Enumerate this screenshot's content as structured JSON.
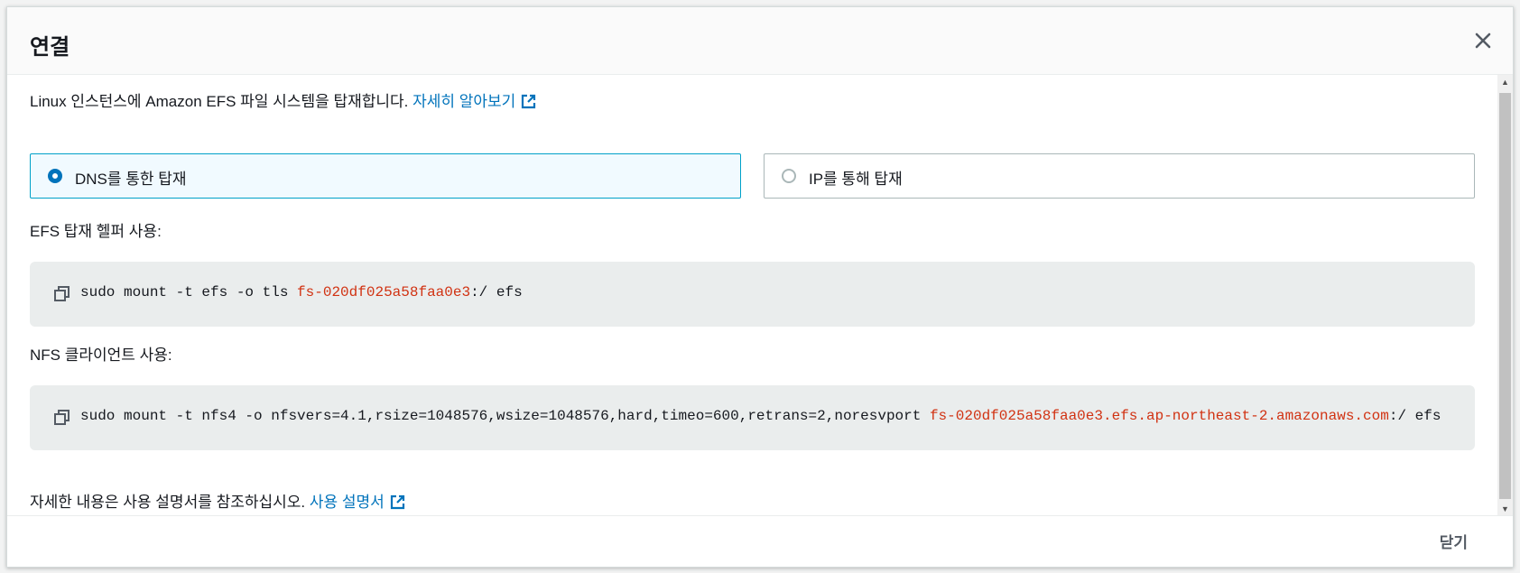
{
  "modal": {
    "title": "연결",
    "intro_text": "Linux 인스턴스에 Amazon EFS 파일 시스템을 탑재합니다. ",
    "intro_link": "자세히 알아보기",
    "options": {
      "dns_label": "DNS를 통한 탑재",
      "ip_label": "IP를 통해 탑재",
      "selected": "dns"
    },
    "efs_helper": {
      "label": "EFS 탑재 헬퍼 사용:",
      "command_prefix": "sudo mount -t efs -o tls ",
      "command_highlight": "fs-020df025a58faa0e3",
      "command_suffix": ":/ efs"
    },
    "nfs_client": {
      "label": "NFS 클라이언트 사용:",
      "command_prefix": "sudo mount -t nfs4 -o nfsvers=4.1,rsize=1048576,wsize=1048576,hard,timeo=600,retrans=2,noresvport ",
      "command_highlight": "fs-020df025a58faa0e3.efs.ap-northeast-2.amazonaws.com",
      "command_suffix": ":/ efs"
    },
    "footer_note_text": "자세한 내용은 사용 설명서를 참조하십시오. ",
    "footer_note_link": "사용 설명서",
    "close_button": "닫기"
  },
  "colors": {
    "link": "#0073bb",
    "code_highlight": "#d13212",
    "selected_border": "#00a1c9"
  },
  "icons": [
    "close-icon",
    "external-link-icon",
    "copy-icon",
    "radio-selected",
    "radio-unselected"
  ]
}
